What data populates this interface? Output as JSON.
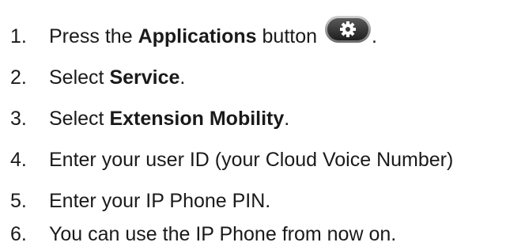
{
  "steps": [
    {
      "number": "1.",
      "prefix": "Press the ",
      "bold": "Applications",
      "suffix": " button",
      "trail": ".",
      "icon": "gear-icon"
    },
    {
      "number": "2.",
      "prefix": "Select ",
      "bold": "Service",
      "suffix": "."
    },
    {
      "number": "3.",
      "prefix": "Select ",
      "bold": "Extension Mobility",
      "suffix": "."
    },
    {
      "number": "4.",
      "text": "Enter your user ID (your Cloud Voice Number)"
    },
    {
      "number": "5.",
      "text": "Enter your IP Phone PIN."
    },
    {
      "number": "6.",
      "text": "You can use the IP Phone from now on."
    }
  ],
  "colors": {
    "text": "#1a1a1a",
    "button_face": "#3a3a3a",
    "button_rim": "#9a9a9a",
    "icon": "#ffffff"
  }
}
